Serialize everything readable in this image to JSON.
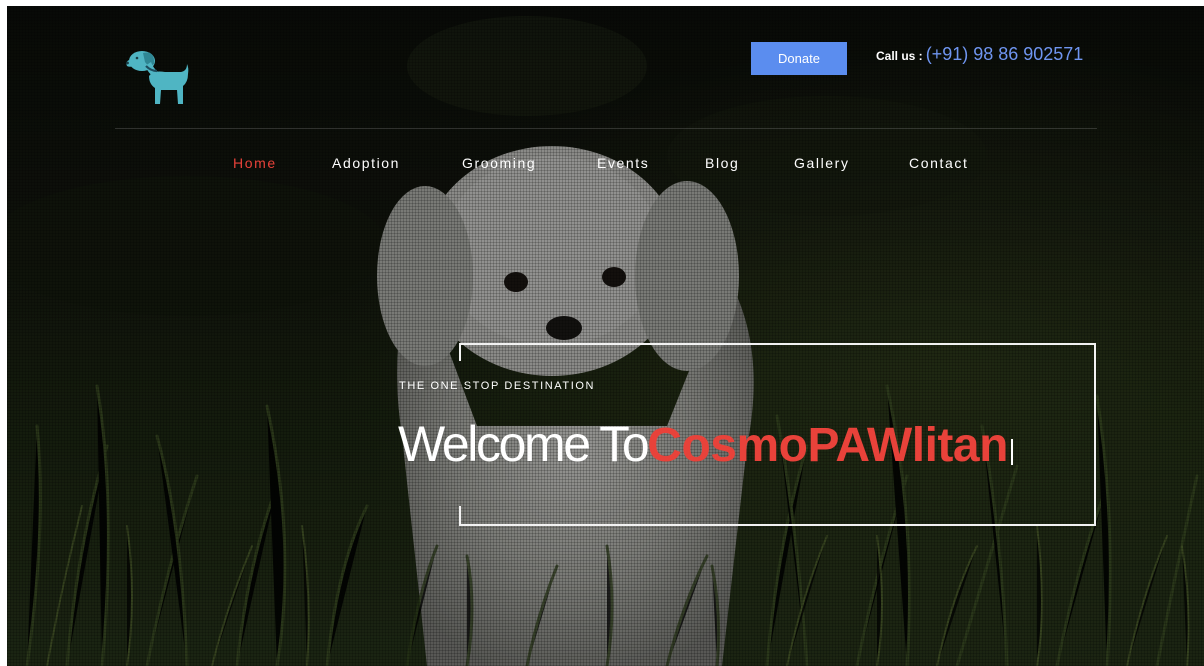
{
  "header": {
    "logo_icon": "dachshund-dog-icon",
    "donate_label": "Donate",
    "call_us_label": "Call us :",
    "phone_number": "(+91) 98 86 902571"
  },
  "nav": {
    "items": [
      {
        "label": "Home",
        "active": true
      },
      {
        "label": "Adoption",
        "active": false
      },
      {
        "label": "Grooming",
        "active": false
      },
      {
        "label": "Events",
        "active": false
      },
      {
        "label": "Blog",
        "active": false
      },
      {
        "label": "Gallery",
        "active": false
      },
      {
        "label": "Contact",
        "active": false
      }
    ]
  },
  "hero": {
    "tagline": "THE ONE STOP DESTINATION",
    "headline_lead": "Welcome To",
    "headline_brand": "CosmoPAWlitan"
  },
  "colors": {
    "accent_red": "#e8423a",
    "donate_blue": "#5b8def",
    "phone_blue": "#6f95f0",
    "logo_teal": "#4fb5c3"
  }
}
